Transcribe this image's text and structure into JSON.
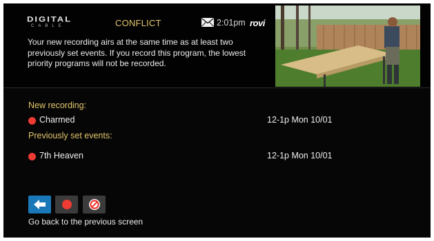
{
  "header": {
    "logo_main": "DIGITAL",
    "logo_sub": "CABLE",
    "title": "CONFLICT",
    "time": "2:01pm",
    "brand": "rovi",
    "mail_icon": "envelope-icon"
  },
  "message": "Your new recording airs at the same time as at least two previously set events. If you record this program, the lowest priority programs will not be recorded.",
  "new_recording": {
    "label": "New recording:",
    "item": {
      "title": "Charmed",
      "time": "12-1p  Mon 10/01"
    }
  },
  "previous_events": {
    "label": "Previously set events:",
    "items": [
      {
        "title": "7th Heaven",
        "time": "12-1p  Mon 10/01"
      }
    ]
  },
  "actions": [
    {
      "icon": "back-arrow-icon"
    },
    {
      "icon": "record-icon"
    },
    {
      "icon": "cancel-icon"
    }
  ],
  "hint": "Go back to the previous screen",
  "colors": {
    "accent": "#e4c66d",
    "record": "#ee3b33",
    "selected_button": "#1a78b8",
    "button": "#3b3b3b"
  }
}
